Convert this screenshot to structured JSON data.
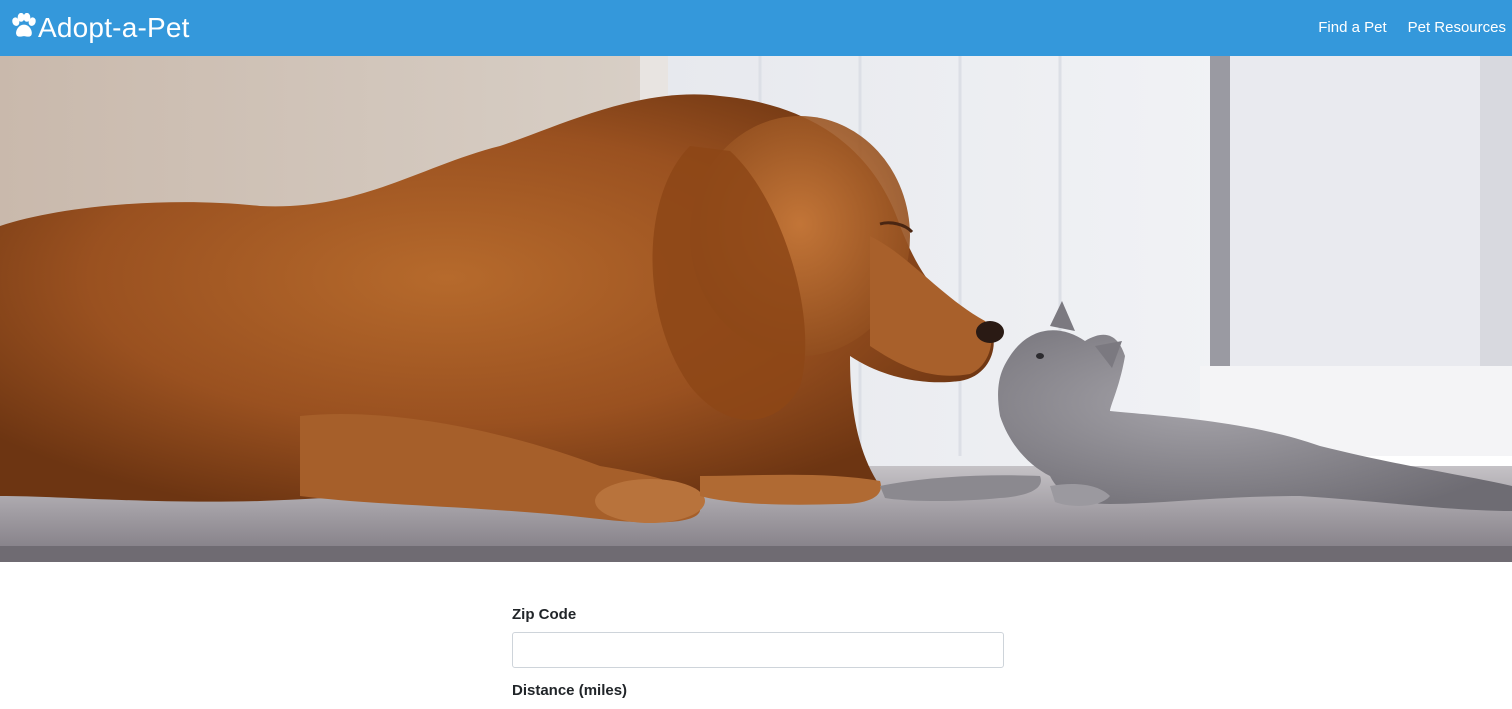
{
  "nav": {
    "brand": "Adopt-a-Pet",
    "brand_icon": "paw-icon",
    "links": [
      "Find a Pet",
      "Pet Resources"
    ]
  },
  "hero": {
    "image": "golden-retriever-and-gray-kitten-touching-noses"
  },
  "form": {
    "zip_label": "Zip Code",
    "zip_value": "",
    "zip_placeholder": "",
    "distance_label": "Distance (miles)"
  },
  "colors": {
    "navbar": "#3498db",
    "nav_text": "#ffffff"
  }
}
